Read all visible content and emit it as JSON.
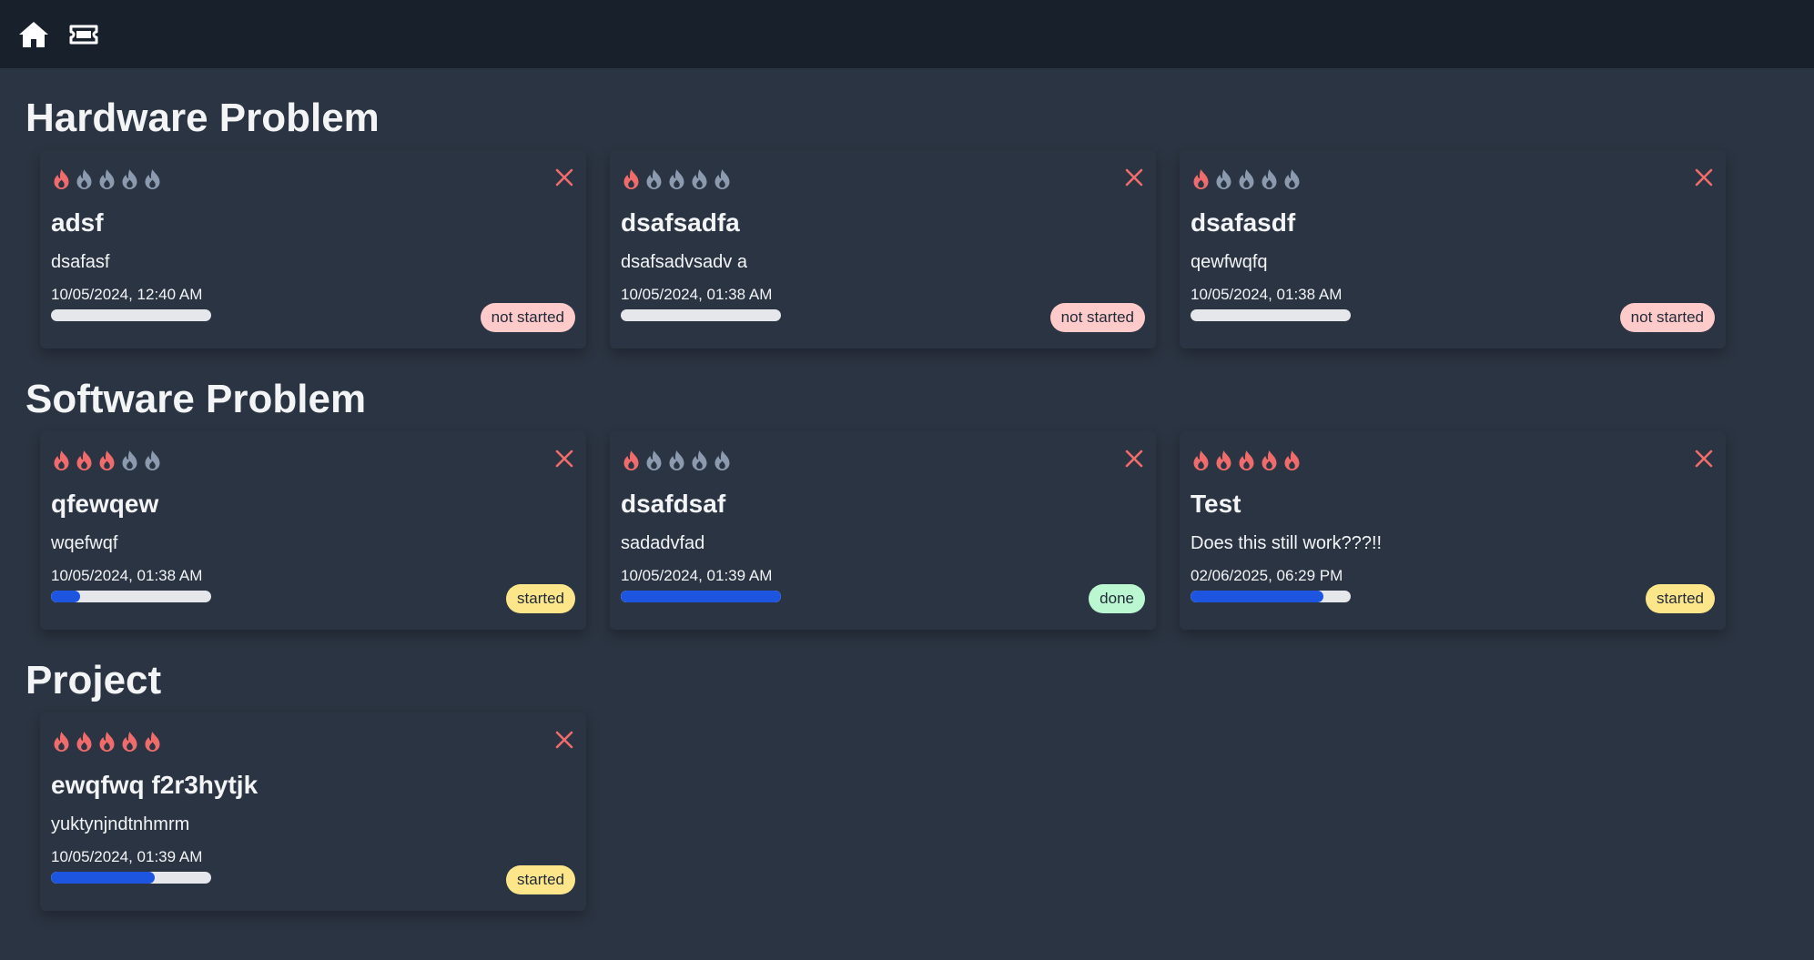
{
  "nav": {
    "home_icon": "home-icon",
    "ticket_icon": "ticket-icon"
  },
  "colors": {
    "flame_active": "#f06c6c",
    "flame_inactive": "#8c9aaf",
    "close": "#f06c6c",
    "progress_fill": "#1d55e0",
    "progress_track": "#e5e7eb",
    "status_not_started": "#fecaca",
    "status_started": "#fde68a",
    "status_done": "#bbf7d0"
  },
  "sections": [
    {
      "title": "Hardware Problem",
      "cards": [
        {
          "priority": 1,
          "title": "adsf",
          "description": "dsafasf",
          "date": "10/05/2024, 12:40 AM",
          "progress": 0,
          "status": "not started"
        },
        {
          "priority": 1,
          "title": "dsafsadfa",
          "description": "dsafsadvsadv a",
          "date": "10/05/2024, 01:38 AM",
          "progress": 0,
          "status": "not started"
        },
        {
          "priority": 1,
          "title": "dsafasdf",
          "description": "qewfwqfq",
          "date": "10/05/2024, 01:38 AM",
          "progress": 0,
          "status": "not started"
        }
      ]
    },
    {
      "title": "Software Problem",
      "cards": [
        {
          "priority": 3,
          "title": "qfewqew",
          "description": "wqefwqf",
          "date": "10/05/2024, 01:38 AM",
          "progress": 0.18,
          "status": "started"
        },
        {
          "priority": 1,
          "title": "dsafdsaf",
          "description": "sadadvfad",
          "date": "10/05/2024, 01:39 AM",
          "progress": 1.0,
          "status": "done"
        },
        {
          "priority": 5,
          "title": "Test",
          "description": "Does this still work???!!",
          "date": "02/06/2025, 06:29 PM",
          "progress": 0.83,
          "status": "started"
        }
      ]
    },
    {
      "title": "Project",
      "cards": [
        {
          "priority": 5,
          "title": "ewqfwq f2r3hytjk",
          "description": "yuktynjndtnhmrm",
          "date": "10/05/2024, 01:39 AM",
          "progress": 0.65,
          "status": "started"
        }
      ]
    }
  ]
}
